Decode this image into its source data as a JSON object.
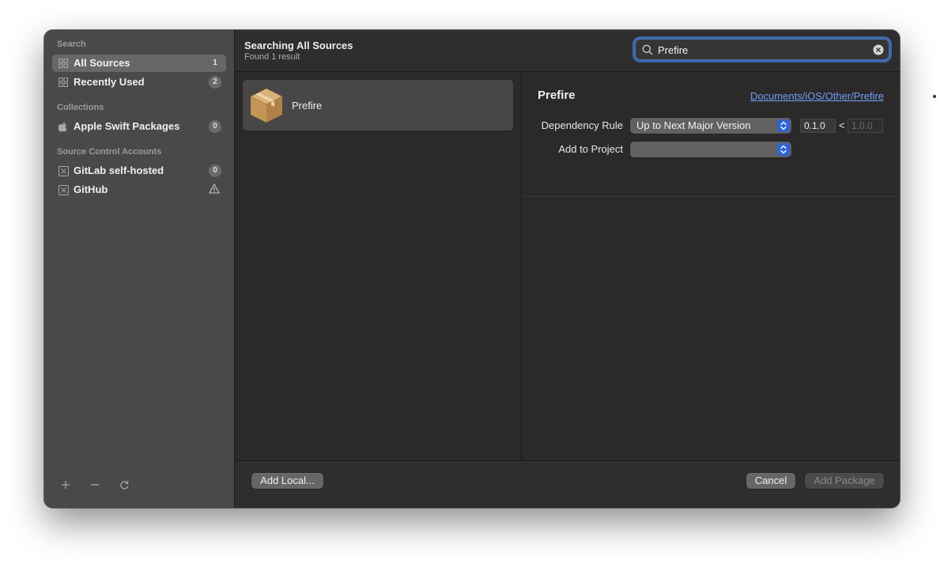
{
  "sidebar": {
    "sections": {
      "search": "Search",
      "collections": "Collections",
      "accounts": "Source Control Accounts"
    },
    "items": [
      {
        "label": "All Sources",
        "badge": "1",
        "icon": "grid-icon",
        "selected": true
      },
      {
        "label": "Recently Used",
        "badge": "2",
        "icon": "grid-icon",
        "selected": false
      },
      {
        "label": "Apple Swift Packages",
        "badge": "0",
        "icon": "apple-icon",
        "selected": false
      },
      {
        "label": "GitLab self-hosted",
        "badge": "0",
        "icon": "account-x-icon",
        "selected": false
      },
      {
        "label": "GitHub",
        "badge": "",
        "icon": "account-x-icon",
        "status": "warning-icon",
        "selected": false
      }
    ],
    "footer": [
      "plus-icon",
      "minus-icon",
      "refresh-icon"
    ]
  },
  "header": {
    "title": "Searching All Sources",
    "subtitle": "Found 1 result",
    "search_value": "Prefire"
  },
  "results": [
    {
      "name": "Prefire",
      "icon": "package-box-icon"
    }
  ],
  "detail": {
    "title": "Prefire",
    "link": "Documents/iOS/Other/Prefire",
    "dependency_rule_label": "Dependency Rule",
    "dependency_rule_value": "Up to Next Major Version",
    "version_from": "0.1.0",
    "less_than": "<",
    "version_to": "1.0.0",
    "add_to_project_label": "Add to Project",
    "add_to_project_value": ""
  },
  "footer": {
    "add_local": "Add Local...",
    "cancel": "Cancel",
    "add_package": "Add Package"
  },
  "colors": {
    "accent": "#2f63d3",
    "link": "#6f9ef8",
    "sidebar_bg": "#4a4948",
    "window_bg": "#2b2929",
    "package_brown": "#c9a063"
  }
}
